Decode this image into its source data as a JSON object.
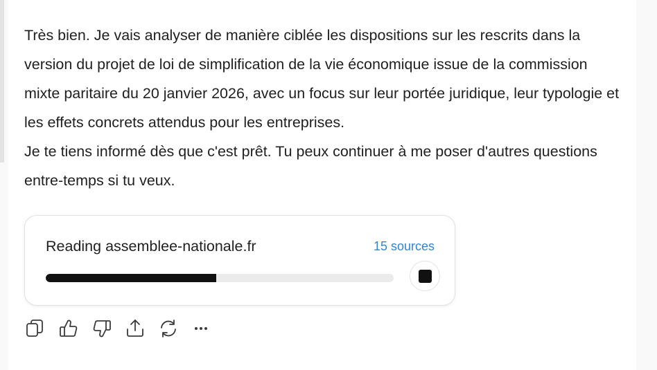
{
  "message": {
    "paragraph_1": "Très bien. Je vais analyser de manière ciblée les dispositions sur les rescrits dans la version du projet de loi de simplification de la vie économique issue de la commission mixte paritaire du 20 janvier 2026, avec un focus sur leur portée juridique, leur typologie et les effets concrets attendus pour les entreprises.",
    "paragraph_2": "Je te tiens informé dès que c'est prêt. Tu peux continuer à me poser d'autres questions entre-temps si tu veux."
  },
  "progress_card": {
    "status_text": "Reading assemblee-nationale.fr",
    "sources_label": "15 sources",
    "progress_fraction": 0.49,
    "stop_icon": "stop-icon"
  },
  "actions": [
    {
      "name": "copy-button",
      "icon": "copy-icon"
    },
    {
      "name": "thumbs-up-button",
      "icon": "thumbs-up-icon"
    },
    {
      "name": "thumbs-down-button",
      "icon": "thumbs-down-icon"
    },
    {
      "name": "share-button",
      "icon": "share-icon"
    },
    {
      "name": "regenerate-button",
      "icon": "refresh-icon"
    },
    {
      "name": "more-button",
      "icon": "more-icon"
    }
  ],
  "colors": {
    "text": "#1f1f1f",
    "link": "#2f84d8",
    "progress_fill": "#111111",
    "progress_track": "#ebebeb",
    "icon": "#3a3a3a"
  }
}
